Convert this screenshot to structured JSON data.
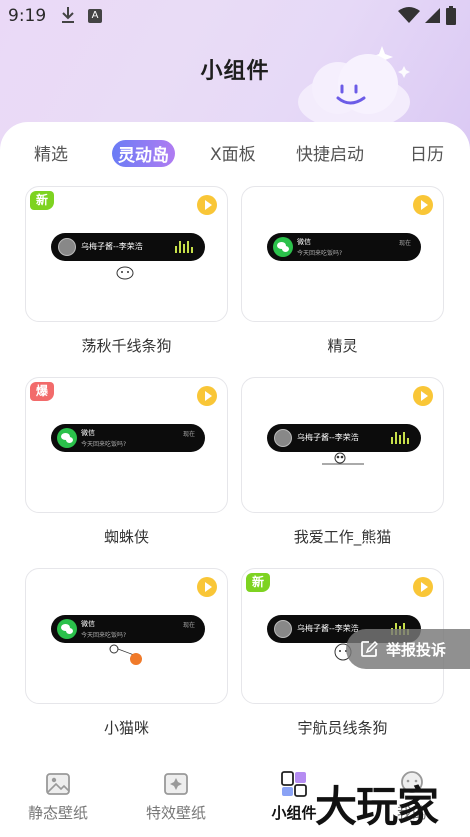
{
  "status_bar": {
    "time": "9:19",
    "a_icon": "A"
  },
  "page": {
    "title": "小组件"
  },
  "tabs": [
    {
      "label": "精选"
    },
    {
      "label": "灵动岛"
    },
    {
      "label": "X面板"
    },
    {
      "label": "快捷启动"
    },
    {
      "label": "日历"
    }
  ],
  "active_tab": "灵动岛",
  "cards": [
    {
      "label": "荡秋千线条狗",
      "badge": "新",
      "pill": {
        "type": "music",
        "text": "乌梅子酱--李荣浩"
      }
    },
    {
      "label": "精灵",
      "badge": "",
      "pill": {
        "type": "message",
        "title": "微信",
        "subtitle": "今天回来吃饭吗?",
        "time": "现在"
      }
    },
    {
      "label": "蜘蛛侠",
      "badge": "爆",
      "pill": {
        "type": "message",
        "title": "微信",
        "subtitle": "今天回来吃饭吗?",
        "time": "现在"
      }
    },
    {
      "label": "我爱工作_熊猫",
      "badge": "",
      "pill": {
        "type": "music",
        "text": "乌梅子酱--李荣浩"
      }
    },
    {
      "label": "小猫咪",
      "badge": "",
      "pill": {
        "type": "message",
        "title": "微信",
        "subtitle": "今天回来吃饭吗?",
        "time": "现在"
      }
    },
    {
      "label": "宇航员线条狗",
      "badge": "新",
      "pill": {
        "type": "music",
        "text": "乌梅子酱--李荣浩"
      }
    }
  ],
  "report_button": {
    "label": "举报投诉"
  },
  "bottom_nav": [
    {
      "label": "静态壁纸",
      "icon": "image-icon"
    },
    {
      "label": "特效壁纸",
      "icon": "sparkle-image-icon"
    },
    {
      "label": "小组件",
      "icon": "widget-icon"
    },
    {
      "label": "我的",
      "icon": "profile-icon"
    }
  ],
  "watermark": "大玩家",
  "colors": {
    "accent_gradient": [
      "#6a7cf5",
      "#b07cf2"
    ],
    "play": "#f9c637",
    "new_badge": "#7ed321",
    "hot_badge": "#f26b6b"
  }
}
